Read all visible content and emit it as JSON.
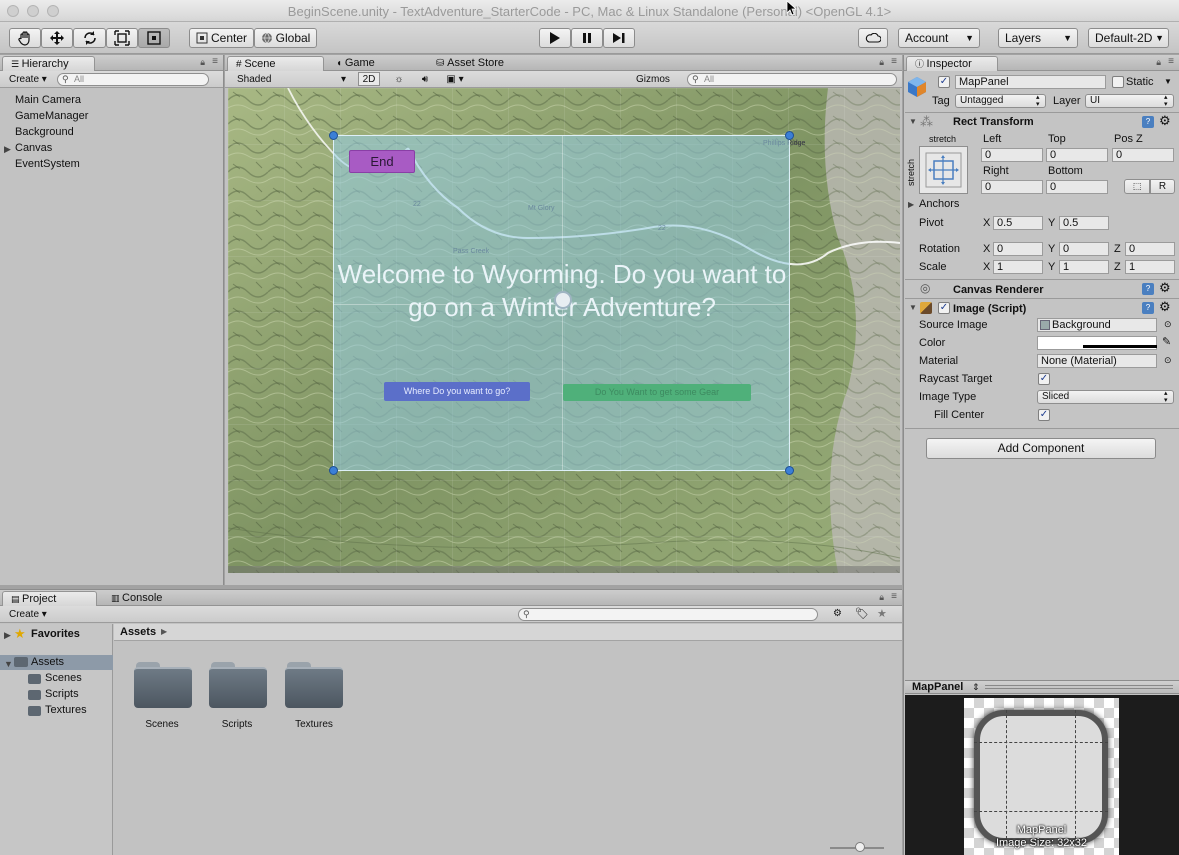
{
  "window": {
    "title": "BeginScene.unity - TextAdventure_StarterCode - PC, Mac & Linux Standalone (Personal) <OpenGL 4.1>"
  },
  "toolbar": {
    "pivot_label": "Center",
    "space_label": "Global",
    "account_label": "Account",
    "layers_label": "Layers",
    "layout_label": "Default-2D"
  },
  "hierarchy": {
    "tab_label": "Hierarchy",
    "create_label": "Create",
    "search_placeholder": "All",
    "items": [
      "Main Camera",
      "GameManager",
      "Background",
      "Canvas",
      "EventSystem"
    ]
  },
  "scene": {
    "tabs": [
      "Scene",
      "Game",
      "Asset Store"
    ],
    "shading_label": "Shaded",
    "mode_2d_label": "2D",
    "gizmos_label": "Gizmos",
    "search_placeholder": "All",
    "panel": {
      "end_button": "End",
      "welcome_text": "Welcome to Wyorming. Do you want to go on a Winter Adventure?",
      "where_button": "Where Do you want to go?",
      "gear_button": "Do You Want to get some Gear"
    },
    "map_labels": [
      "Mt Glory",
      "Phillips Ridge",
      "22",
      "22",
      "Pass Creek"
    ]
  },
  "project": {
    "tabs": [
      "Project",
      "Console"
    ],
    "create_label": "Create",
    "favorites_label": "Favorites",
    "assets_label": "Assets",
    "tree": [
      "Scenes",
      "Scripts",
      "Textures"
    ],
    "breadcrumb": "Assets",
    "folders": [
      "Scenes",
      "Scripts",
      "Textures"
    ]
  },
  "inspector": {
    "tab_label": "Inspector",
    "object_name": "MapPanel",
    "static_label": "Static",
    "tag_label": "Tag",
    "tag_value": "Untagged",
    "layer_label": "Layer",
    "layer_value": "UI",
    "rect_transform": {
      "title": "Rect Transform",
      "stretch_top": "stretch",
      "stretch_side": "stretch",
      "left_label": "Left",
      "left_value": "0",
      "top_label": "Top",
      "top_value": "0",
      "posz_label": "Pos Z",
      "posz_value": "0",
      "right_label": "Right",
      "right_value": "0",
      "bottom_label": "Bottom",
      "bottom_value": "0",
      "r_button": "R",
      "anchors_label": "Anchors",
      "pivot_label": "Pivot",
      "pivot_x": "0.5",
      "pivot_y": "0.5",
      "rotation_label": "Rotation",
      "rot_x": "0",
      "rot_y": "0",
      "rot_z": "0",
      "scale_label": "Scale",
      "scale_x": "1",
      "scale_y": "1",
      "scale_z": "1",
      "x": "X",
      "y": "Y",
      "z": "Z"
    },
    "canvas_renderer": {
      "title": "Canvas Renderer"
    },
    "image_script": {
      "title": "Image (Script)",
      "source_label": "Source Image",
      "source_value": "Background",
      "color_label": "Color",
      "material_label": "Material",
      "material_value": "None (Material)",
      "raycast_label": "Raycast Target",
      "type_label": "Image Type",
      "type_value": "Sliced",
      "fill_label": "Fill Center"
    },
    "add_component": "Add Component",
    "preview": {
      "title": "MapPanel",
      "caption_name": "MapPanel",
      "caption_size": "Image Size: 32x32"
    }
  },
  "colors": {
    "selection_blue": "#3d6ab5",
    "panel_overlay": "#9fd3e8",
    "end_button": "#a85bc4",
    "where_button": "#5b6fc9",
    "gear_button": "#4fb07a"
  }
}
